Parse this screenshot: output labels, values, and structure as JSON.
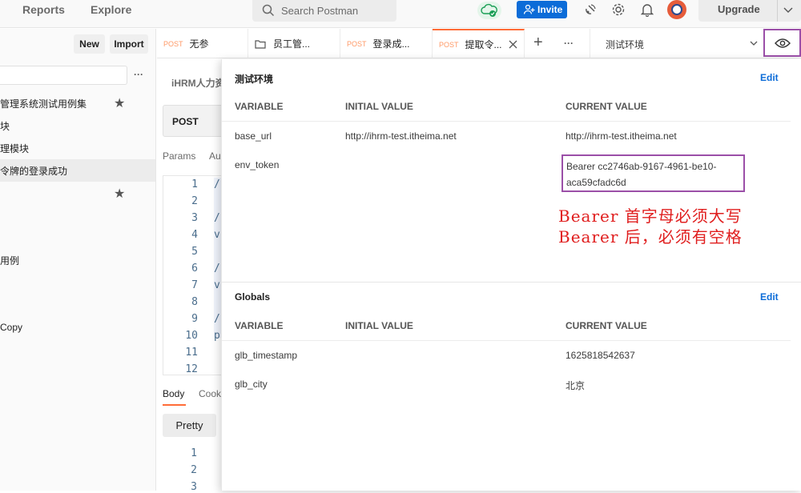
{
  "topbar": {
    "nav": [
      "Reports",
      "Explore"
    ],
    "search_placeholder": "Search Postman",
    "invite_label": "Invite",
    "upgrade_label": "Upgrade"
  },
  "sidebar": {
    "new_label": "New",
    "import_label": "Import",
    "more_label": "···",
    "items": [
      {
        "label": "管理系统测试用例集",
        "starred": true
      },
      {
        "label": "块"
      },
      {
        "label": "理模块"
      },
      {
        "label": "令牌的登录成功",
        "selected": true
      },
      {
        "label": "",
        "starred": true
      },
      {
        "label": "用例"
      },
      {
        "label": "Copy"
      }
    ]
  },
  "tabs": [
    {
      "method": "POST",
      "label": "无参"
    },
    {
      "method": "",
      "label": "员工管...",
      "icon": "folder-icon"
    },
    {
      "method": "POST",
      "label": "登录成..."
    },
    {
      "method": "POST",
      "label": "提取令...",
      "active": true
    }
  ],
  "tab_add_label": "+",
  "tab_more_label": "···",
  "environment": {
    "selected": "测试环境"
  },
  "request": {
    "breadcrumb": "iHRM人力资",
    "method": "POST",
    "tabs": [
      "Params",
      "Au"
    ],
    "line_numbers": [
      "1",
      "2",
      "3",
      "4",
      "5",
      "6",
      "7",
      "8",
      "9",
      "10",
      "11",
      "12"
    ],
    "code_chars": [
      "/",
      "",
      "/",
      "v",
      "",
      "/",
      "v",
      "",
      "/",
      "p",
      "",
      ""
    ],
    "response_tabs": [
      "Body",
      "Cook"
    ],
    "pretty_label": "Pretty",
    "response_lines": [
      "1",
      "2",
      "3"
    ]
  },
  "panel": {
    "env_title": "测试环境",
    "edit_label": "Edit",
    "columns": [
      "VARIABLE",
      "INITIAL VALUE",
      "CURRENT VALUE"
    ],
    "env_rows": [
      {
        "variable": "base_url",
        "initial": "http://ihrm-test.itheima.net",
        "current": "http://ihrm-test.itheima.net"
      },
      {
        "variable": "env_token",
        "initial": "",
        "current_line1": "Bearer cc2746ab-9167-4961-be10-",
        "current_line2": "aca59cfadc6d"
      }
    ],
    "annotation": [
      "Bearer 首字母必须大写",
      "Bearer 后，必须有空格"
    ],
    "globals_title": "Globals",
    "global_rows": [
      {
        "variable": "glb_timestamp",
        "initial": "",
        "current": "1625818542637"
      },
      {
        "variable": "glb_city",
        "initial": "",
        "current": "北京"
      }
    ]
  },
  "colors": {
    "accent": "#ff6c37",
    "link": "#0c6cd8",
    "highlight": "#9b4fa8",
    "annotation": "#e01e1e"
  }
}
